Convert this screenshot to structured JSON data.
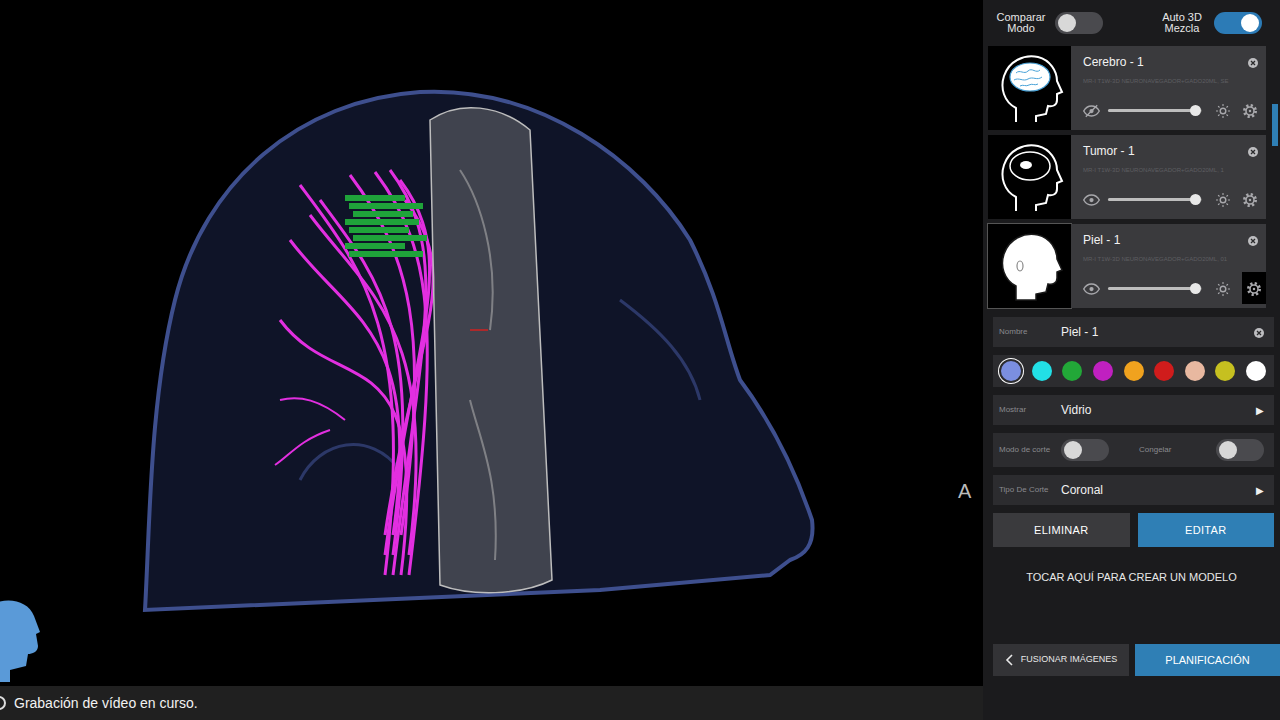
{
  "header": {
    "compare": {
      "label": "Comparar Modo",
      "on": false
    },
    "blend": {
      "label": "Auto 3D Mezcla",
      "on": true
    }
  },
  "models": [
    {
      "name": "Cerebro - 1",
      "source": "MR-I T1W-3D NEURONAVEGADOR+GADO20ML, SE",
      "kind": "brain",
      "visible": false,
      "level": 0.93,
      "selected": false
    },
    {
      "name": "Tumor - 1",
      "source": "MR-I T1W-3D NEURONAVEGADOR+GADO20ML, 1",
      "kind": "tumor",
      "visible": true,
      "level": 0.93,
      "selected": false
    },
    {
      "name": "Piel - 1",
      "source": "MR-I T1W-3D NEURONAVEGADOR+GADO20ML, 01",
      "kind": "skin",
      "visible": true,
      "level": 0.93,
      "selected": true
    }
  ],
  "settings": {
    "name_label": "Nombre",
    "name_value": "Piel - 1",
    "colors": [
      {
        "color": "#7b8fe0",
        "selected": true
      },
      {
        "color": "#22e0e6",
        "selected": false
      },
      {
        "color": "#22a838",
        "selected": false
      },
      {
        "color": "#c020c0",
        "selected": false
      },
      {
        "color": "#f0a21e",
        "selected": false
      },
      {
        "color": "#d01c1c",
        "selected": false
      },
      {
        "color": "#e8b8a0",
        "selected": false
      },
      {
        "color": "#c6c020",
        "selected": false
      },
      {
        "color": "#ffffff",
        "selected": false
      }
    ],
    "display": {
      "label": "Mostrar",
      "value": "Vidrio",
      "arrow": "▶"
    },
    "cut_mode": {
      "label": "Modo de corte",
      "on": false
    },
    "freeze": {
      "label": "Congelar",
      "on": false
    },
    "cut_type": {
      "label": "Tipo De Corte",
      "value": "Coronal",
      "arrow": "▶"
    },
    "buttons": [
      "ELIMINAR",
      "EDITAR"
    ]
  },
  "create": "TOCAR AQUÍ PARA CREAR UN MODELO",
  "nav": {
    "back": "FUSIONAR IMÁGENES",
    "next": "PLANIFICACIÓN"
  },
  "viewport": {
    "orientation": "A"
  },
  "status": "Grabación de vídeo en curso."
}
